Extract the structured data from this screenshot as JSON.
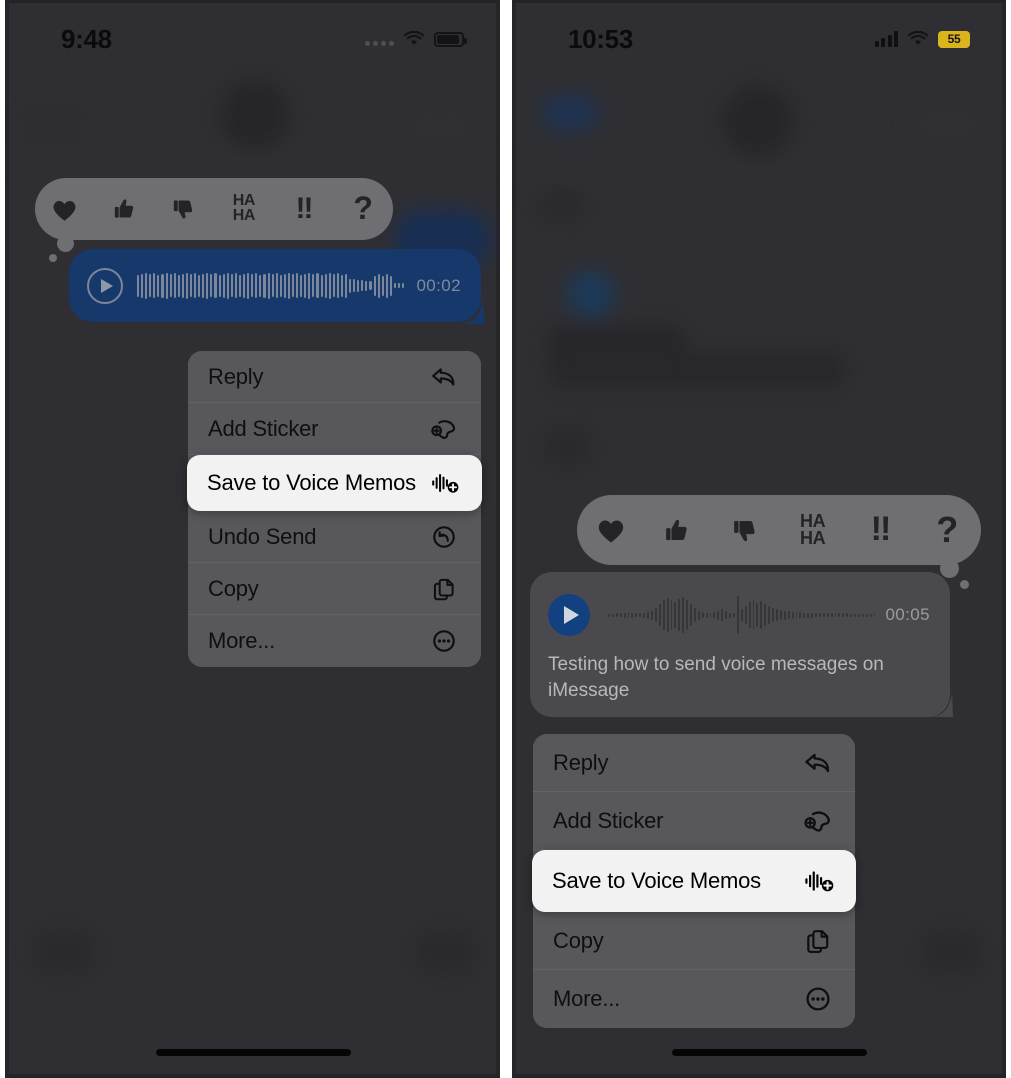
{
  "panels": [
    {
      "id": "left",
      "statusbar": {
        "time": "9:48",
        "signal_icon": "cellular-dots-icon",
        "wifi_icon": "wifi-icon",
        "battery_icon": "battery-icon",
        "battery_label": ""
      },
      "tapback": {
        "reactions": [
          {
            "name": "heart-reaction",
            "glyph": "♥"
          },
          {
            "name": "thumbs-up-reaction",
            "glyph": "👍"
          },
          {
            "name": "thumbs-down-reaction",
            "glyph": "👎"
          },
          {
            "name": "haha-reaction",
            "line1": "HA",
            "line2": "HA"
          },
          {
            "name": "exclamation-reaction",
            "glyph": "!!"
          },
          {
            "name": "question-reaction",
            "glyph": "?"
          }
        ]
      },
      "message": {
        "type": "voice-message",
        "side": "outgoing",
        "play_label": "Play",
        "duration": "00:02",
        "transcript": "",
        "bubble_color": "#16386b"
      },
      "menu": [
        {
          "label": "Reply",
          "icon": "reply-arrow-icon",
          "highlighted": false
        },
        {
          "label": "Add Sticker",
          "icon": "sticker-icon",
          "highlighted": false
        },
        {
          "label": "Save to Voice Memos",
          "icon": "waveform-plus-icon",
          "highlighted": true
        },
        {
          "label": "Undo Send",
          "icon": "undo-circle-icon",
          "highlighted": false
        },
        {
          "label": "Copy",
          "icon": "copy-pages-icon",
          "highlighted": false
        },
        {
          "label": "More...",
          "icon": "more-circle-icon",
          "highlighted": false
        }
      ]
    },
    {
      "id": "right",
      "statusbar": {
        "time": "10:53",
        "signal_icon": "cellular-bars-icon",
        "wifi_icon": "wifi-icon",
        "battery_icon": "battery-percent-icon",
        "battery_label": "55"
      },
      "tapback": {
        "reactions": [
          {
            "name": "heart-reaction",
            "glyph": "♥"
          },
          {
            "name": "thumbs-up-reaction",
            "glyph": "👍"
          },
          {
            "name": "thumbs-down-reaction",
            "glyph": "👎"
          },
          {
            "name": "haha-reaction",
            "line1": "HA",
            "line2": "HA"
          },
          {
            "name": "exclamation-reaction",
            "glyph": "!!"
          },
          {
            "name": "question-reaction",
            "glyph": "?"
          }
        ]
      },
      "message": {
        "type": "voice-message",
        "side": "incoming",
        "play_label": "Play",
        "duration": "00:05",
        "transcript": "Testing how to send voice messages on iMessage",
        "bubble_color": "#4a4a4e"
      },
      "menu": [
        {
          "label": "Reply",
          "icon": "reply-arrow-icon",
          "highlighted": false
        },
        {
          "label": "Add Sticker",
          "icon": "sticker-icon",
          "highlighted": false
        },
        {
          "label": "Save to Voice Memos",
          "icon": "waveform-plus-icon",
          "highlighted": true
        },
        {
          "label": "Copy",
          "icon": "copy-pages-icon",
          "highlighted": false
        },
        {
          "label": "More...",
          "icon": "more-circle-icon",
          "highlighted": false
        }
      ]
    }
  ],
  "colors": {
    "page_background": "#ffffff",
    "screen_background": "#3b3b3f",
    "menu_background": "#58585c",
    "menu_highlight": "#f2f2f3",
    "bubble_blue": "#16386b",
    "bubble_gray": "#4a4a4e",
    "tapbar": "#6f6f73",
    "accent_blue": "#13417f",
    "battery_yellow": "#d9b41d"
  }
}
